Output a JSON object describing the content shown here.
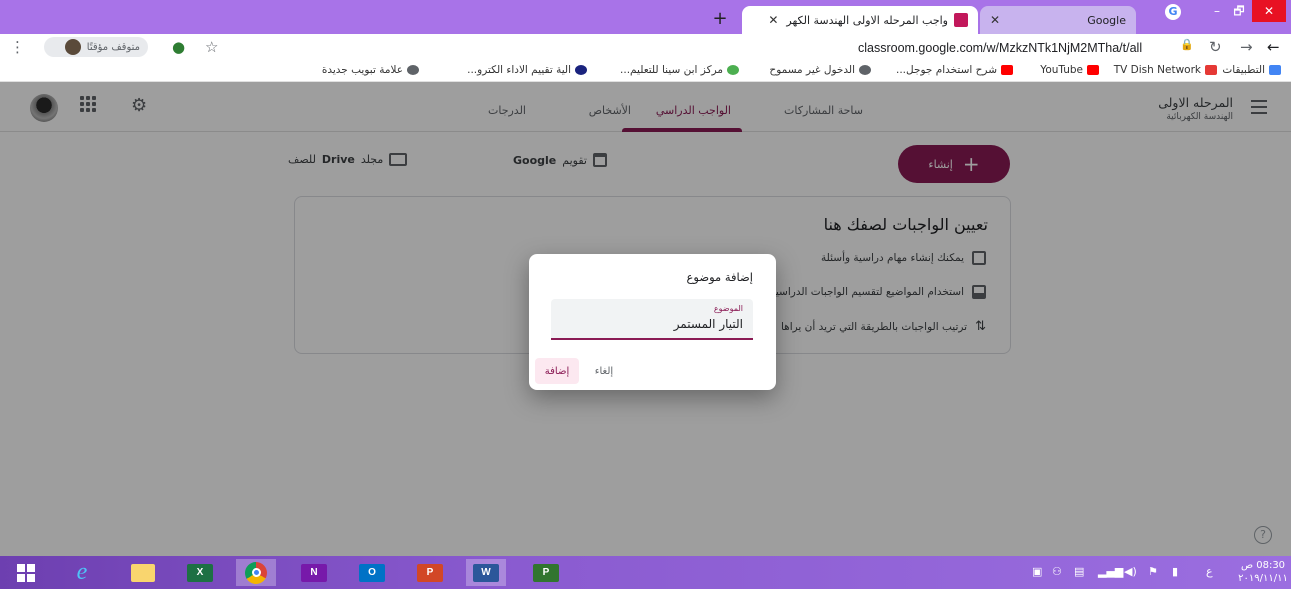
{
  "browser": {
    "tabs": [
      {
        "title": "واجب المرحله الاولى الهندسة الكهر",
        "active": true,
        "icon": "classroom-icon"
      },
      {
        "title": "Google",
        "active": false,
        "icon": "google-icon"
      }
    ],
    "new_tab_glyph": "+",
    "window_controls": {
      "minimize": "–",
      "maximize": "🗗",
      "close": "✕"
    },
    "url": "classroom.google.com/w/MzkzNTk1NjM2MTha/t/all",
    "paused_label": "متوقف مؤقتًا",
    "star_glyph": "☆",
    "more_glyph": "⋮",
    "back_glyph": "←",
    "forward_glyph": "→",
    "reload_glyph": "↻",
    "lock_glyph": "🔒"
  },
  "bookmarks": [
    {
      "label": "التطبيقات",
      "icon": "apps-grid-icon",
      "color": "#4285f4"
    },
    {
      "label": "TV Dish Network",
      "icon": "dish-icon",
      "color": "#e53935"
    },
    {
      "label": "YouTube",
      "icon": "youtube-icon",
      "color": "#ff0000"
    },
    {
      "label": "شرح استخدام جوجل...",
      "icon": "youtube-icon",
      "color": "#ff0000"
    },
    {
      "label": "الدخول غير مسموح",
      "icon": "globe-icon",
      "color": "#5f6368"
    },
    {
      "label": "مركز ابن سينا للتعليم...",
      "icon": "site-icon",
      "color": "#4caf50"
    },
    {
      "label": "الية تقييم الاداء الكترو...",
      "icon": "site-icon",
      "color": "#1a237e"
    },
    {
      "label": "علامة تبويب جديدة",
      "icon": "globe-icon",
      "color": "#5f6368"
    }
  ],
  "classroom": {
    "class_name": "المرحله الاولى",
    "class_section": "الهندسة الكهربائية",
    "nav_tabs": [
      {
        "label": "ساحة المشاركات",
        "active": false
      },
      {
        "label": "الواجب الدراسي",
        "active": true
      },
      {
        "label": "الأشخاص",
        "active": false
      },
      {
        "label": "الدرجات",
        "active": false
      }
    ],
    "create_label": "إنشاء",
    "create_glyph": "+",
    "calendar_label_prefix": "تقويم",
    "calendar_label_bold": "Google",
    "drive_label_prefix": "مجلد",
    "drive_label_bold": "Drive",
    "drive_label_suffix": "للصف",
    "empty_title": "تعيين الواجبات لصفك هنا",
    "empty_items": [
      {
        "text": "يمكنك إنشاء مهام دراسية وأسئلة",
        "icon": "assignment-icon"
      },
      {
        "text": "استخدام المواضيع لتقسيم الواجبات الدراسية",
        "icon": "topic-list-icon"
      },
      {
        "text": "ترتيب الواجبات بالطريقة التي تريد أن يراها",
        "icon": "reorder-icon"
      }
    ],
    "help_glyph": "?"
  },
  "dialog": {
    "title": "إضافة موضوع",
    "field_label": "الموضوع",
    "field_value": "التيار المستمر",
    "cancel_label": "إلغاء",
    "add_label": "إضافة"
  },
  "taskbar": {
    "apps": [
      {
        "name": "start",
        "label": ""
      },
      {
        "name": "internet-explorer",
        "label": "e"
      },
      {
        "name": "file-explorer",
        "label": ""
      },
      {
        "name": "excel",
        "label": "X"
      },
      {
        "name": "chrome",
        "label": ""
      },
      {
        "name": "onenote",
        "label": "N"
      },
      {
        "name": "outlook",
        "label": "O"
      },
      {
        "name": "powerpoint",
        "label": "P"
      },
      {
        "name": "word",
        "label": "W"
      },
      {
        "name": "project",
        "label": "P"
      }
    ],
    "lang": "ع",
    "time": "08:30 ص",
    "date": "٢٠١٩/١١/١١"
  }
}
